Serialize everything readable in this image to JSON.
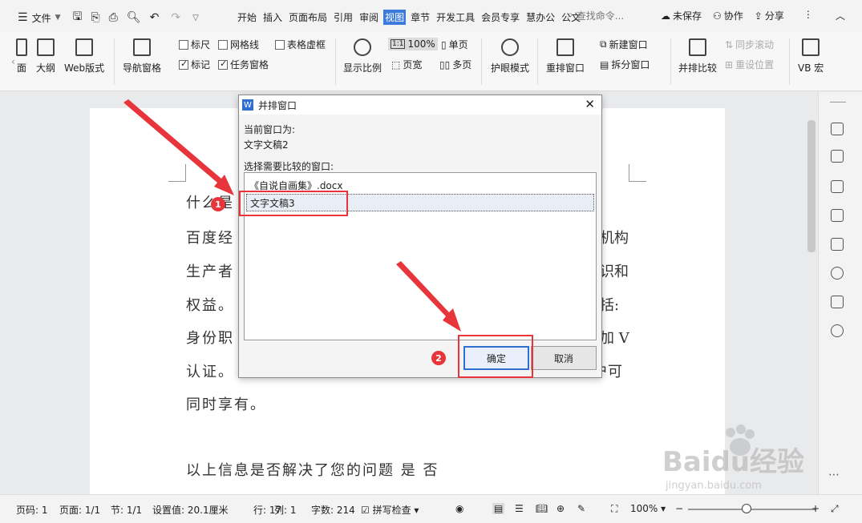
{
  "menubar": {
    "file_label": "文件",
    "tabs": [
      "开始",
      "插入",
      "页面布局",
      "引用",
      "审阅",
      "视图",
      "章节",
      "开发工具",
      "会员专享",
      "慧办公",
      "公文"
    ],
    "active_tab_index": 5,
    "search_placeholder": "查找命令...",
    "unsaved": "未保存",
    "collab": "协作",
    "share": "分享"
  },
  "ribbon": {
    "page_frag": "面",
    "outline": "大纲",
    "web": "Web版式",
    "nav_pane": "导航窗格",
    "ruler": "标尺",
    "gridlines": "网格线",
    "table_lines": "表格虚框",
    "marks": "标记",
    "task_pane": "任务窗格",
    "zoom_label": "显示比例",
    "zoom_value": "100%",
    "single_page": "单页",
    "page_width": "页宽",
    "multi_page": "多页",
    "eye_mode": "护眼模式",
    "rearrange": "重排窗口",
    "new_window": "新建窗口",
    "split_window": "拆分窗口",
    "side_by_side": "并排比较",
    "sync_scroll": "同步滚动",
    "reset_pos": "重设位置",
    "vb_macro": "VB 宏"
  },
  "document": {
    "line1": "什么是",
    "line2": "百度经",
    "line2_right": "机构",
    "line3": "生产者",
    "line3_right": "识和",
    "line4": "权益。",
    "line4_right": "括:",
    "line5": "身份职",
    "line5_right": "加 V",
    "line6": "认证。",
    "line6_right": "户可",
    "line7": "同时享有。",
    "line8": "以上信息是否解决了您的问题 是 否"
  },
  "dialog": {
    "title": "并排窗口",
    "current_label": "当前窗口为:",
    "current_value": "文字文稿2",
    "select_label": "选择需要比较的窗口:",
    "items": [
      "《自说自画集》.docx",
      "文字文稿3"
    ],
    "ok": "确定",
    "cancel": "取消"
  },
  "annotations": {
    "badge1": "1",
    "badge2": "2"
  },
  "statusbar": {
    "page_no": "页码: 1",
    "pages": "页面: 1/1",
    "section": "节: 1/1",
    "setting": "设置值: 20.1厘米",
    "row": "行: 17",
    "col": "列: 1",
    "words": "字数: 214",
    "spell": "拼写检查",
    "zoom": "100%"
  },
  "watermark": {
    "brand": "Baidu经验",
    "url": "jingyan.baidu.com"
  },
  "colors": {
    "accent": "#3b7bdc",
    "annotation_red": "#e8353b"
  }
}
